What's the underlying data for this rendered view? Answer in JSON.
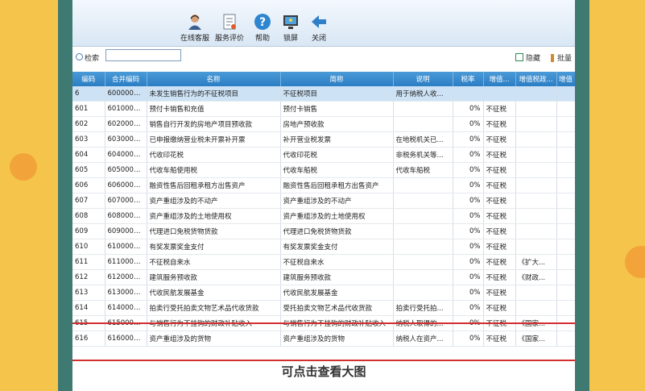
{
  "toolbar": {
    "items": [
      {
        "label": "在线客服",
        "icon": "customer-service-icon"
      },
      {
        "label": "服务评价",
        "icon": "evaluation-icon"
      },
      {
        "label": "帮助",
        "icon": "help-icon"
      },
      {
        "label": "锁屏",
        "icon": "lock-screen-icon"
      },
      {
        "label": "关闭",
        "icon": "close-arrow-icon"
      }
    ]
  },
  "search": {
    "label": "检索",
    "value": ""
  },
  "actions": {
    "hide_label": "隐藏",
    "batch_label": "批量"
  },
  "table": {
    "columns": [
      "编码",
      "合并编码",
      "名称",
      "简称",
      "说明",
      "税率",
      "增值...",
      "增值税政...",
      "增值"
    ],
    "rows": [
      {
        "code": "6",
        "merge": "6000000...",
        "name": "未发生销售行为的不征税项目",
        "short": "不征税项目",
        "desc": "用于纳税人收...",
        "rate": "",
        "vat": "",
        "policy": "",
        "x": ""
      },
      {
        "code": "601",
        "merge": "6010000...",
        "name": "预付卡销售和充值",
        "short": "预付卡销售",
        "desc": "",
        "rate": "0%",
        "vat": "不征税",
        "policy": "",
        "x": ""
      },
      {
        "code": "602",
        "merge": "6020000...",
        "name": "销售自行开发的房地产项目预收款",
        "short": "房地产预收款",
        "desc": "",
        "rate": "0%",
        "vat": "不征税",
        "policy": "",
        "x": ""
      },
      {
        "code": "603",
        "merge": "6030000...",
        "name": "已申报缴纳营业税未开票补开票",
        "short": "补开营业税发票",
        "desc": "在地税机关已...",
        "rate": "0%",
        "vat": "不征税",
        "policy": "",
        "x": ""
      },
      {
        "code": "604",
        "merge": "6040000...",
        "name": "代收印花税",
        "short": "代收印花税",
        "desc": "非税务机关等...",
        "rate": "0%",
        "vat": "不征税",
        "policy": "",
        "x": ""
      },
      {
        "code": "605",
        "merge": "6050000...",
        "name": "代收车船使用税",
        "short": "代收车船税",
        "desc": "代收车船税",
        "rate": "0%",
        "vat": "不征税",
        "policy": "",
        "x": ""
      },
      {
        "code": "606",
        "merge": "6060000...",
        "name": "融资性售后回租承租方出售资产",
        "short": "融资性售后回租承租方出售资产",
        "desc": "",
        "rate": "0%",
        "vat": "不征税",
        "policy": "",
        "x": ""
      },
      {
        "code": "607",
        "merge": "6070000...",
        "name": "资产重组涉及的不动产",
        "short": "资产重组涉及的不动产",
        "desc": "",
        "rate": "0%",
        "vat": "不征税",
        "policy": "",
        "x": ""
      },
      {
        "code": "608",
        "merge": "6080000...",
        "name": "资产重组涉及的土地使用权",
        "short": "资产重组涉及的土地使用权",
        "desc": "",
        "rate": "0%",
        "vat": "不征税",
        "policy": "",
        "x": ""
      },
      {
        "code": "609",
        "merge": "6090000...",
        "name": "代理进口免税货物货款",
        "short": "代理进口免税货物货款",
        "desc": "",
        "rate": "0%",
        "vat": "不征税",
        "policy": "",
        "x": ""
      },
      {
        "code": "610",
        "merge": "6100000...",
        "name": "有奖发票奖金支付",
        "short": "有奖发票奖金支付",
        "desc": "",
        "rate": "0%",
        "vat": "不征税",
        "policy": "",
        "x": ""
      },
      {
        "code": "611",
        "merge": "6110000...",
        "name": "不征税自来水",
        "short": "不征税自来水",
        "desc": "",
        "rate": "0%",
        "vat": "不征税",
        "policy": "《扩大...",
        "x": ""
      },
      {
        "code": "612",
        "merge": "6120000...",
        "name": "建筑服务预收款",
        "short": "建筑服务预收款",
        "desc": "",
        "rate": "0%",
        "vat": "不征税",
        "policy": "《财政...",
        "x": ""
      },
      {
        "code": "613",
        "merge": "6130000...",
        "name": "代收民航发展基金",
        "short": "代收民航发展基金",
        "desc": "",
        "rate": "0%",
        "vat": "不征税",
        "policy": "",
        "x": ""
      },
      {
        "code": "614",
        "merge": "6140000...",
        "name": "拍卖行受托拍卖文物艺术品代收货款",
        "short": "受托拍卖文物艺术品代收货款",
        "desc": "拍卖行受托拍...",
        "rate": "0%",
        "vat": "不征税",
        "policy": "",
        "x": ""
      },
      {
        "code": "615",
        "merge": "6150000...",
        "name": "与销售行为不挂钩的财政补贴收入",
        "short": "与销售行为不挂钩的财政补贴收入",
        "desc": "纳税人取得的...",
        "rate": "0%",
        "vat": "不征税",
        "policy": "《国家...",
        "x": ""
      },
      {
        "code": "616",
        "merge": "6160000...",
        "name": "资产重组涉及的货物",
        "short": "资产重组涉及的货物",
        "desc": "纳税人在资产...",
        "rate": "0%",
        "vat": "不征税",
        "policy": "《国家...",
        "x": ""
      }
    ]
  },
  "caption": "可点击查看大图",
  "colors": {
    "header_blue": "#2c7ec4",
    "selected_row": "#cde2f5",
    "red_line": "#d32f2f",
    "frame_yellow": "#f4c44b",
    "frame_teal": "#3f7a72"
  }
}
